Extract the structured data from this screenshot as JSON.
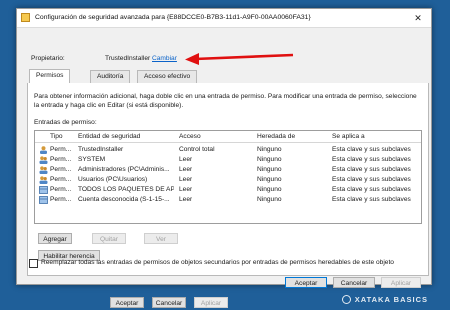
{
  "window": {
    "title": "Configuración de seguridad avanzada para {E88DCCE0-B7B3-11d1-A9F0-00AA0060FA31}",
    "close_symbol": "✕"
  },
  "owner": {
    "label": "Propietario:",
    "value": "TrustedInstaller",
    "change": "Cambiar"
  },
  "tabs": [
    {
      "label": "Permisos",
      "active": true
    },
    {
      "label": "Auditoría",
      "active": false
    },
    {
      "label": "Acceso efectivo",
      "active": false
    }
  ],
  "info_text": "Para obtener información adicional, haga doble clic en una entrada de permiso. Para modificar una entrada de permiso, seleccione la entrada y haga clic en Editar (si está disponible).",
  "entries_label": "Entradas de permiso:",
  "columns": [
    "Tipo",
    "Entidad de seguridad",
    "Acceso",
    "Heredada de",
    "Se aplica a"
  ],
  "rows": [
    {
      "icon": "user-icon",
      "type": "Perm...",
      "principal": "TrustedInstaller",
      "access": "Control total",
      "inherited": "Ninguno",
      "applies": "Esta clave y sus subclaves"
    },
    {
      "icon": "group-icon",
      "type": "Perm...",
      "principal": "SYSTEM",
      "access": "Leer",
      "inherited": "Ninguno",
      "applies": "Esta clave y sus subclaves"
    },
    {
      "icon": "group-icon",
      "type": "Perm...",
      "principal": "Administradores (PC\\Adminis...",
      "access": "Leer",
      "inherited": "Ninguno",
      "applies": "Esta clave y sus subclaves"
    },
    {
      "icon": "group-icon",
      "type": "Perm...",
      "principal": "Usuarios (PC\\Usuarios)",
      "access": "Leer",
      "inherited": "Ninguno",
      "applies": "Esta clave y sus subclaves"
    },
    {
      "icon": "package-icon",
      "type": "Perm...",
      "principal": "TODOS LOS PAQUETES DE AP...",
      "access": "Leer",
      "inherited": "Ninguno",
      "applies": "Esta clave y sus subclaves"
    },
    {
      "icon": "package-icon",
      "type": "Perm...",
      "principal": "Cuenta desconocida (S-1-15-...",
      "access": "Leer",
      "inherited": "Ninguno",
      "applies": "Esta clave y sus subclaves"
    }
  ],
  "buttons": {
    "add": "Agregar",
    "remove": "Quitar",
    "view": "Ver",
    "enable_inheritance": "Habilitar herencia",
    "ok": "Aceptar",
    "cancel": "Cancelar",
    "apply": "Aplicar"
  },
  "replace_checkbox": {
    "label": "Reemplazar todas las entradas de permisos de objetos secundarios por entradas de permisos heredables de este objeto",
    "checked": false
  },
  "background_dialog_buttons": {
    "ok": "Aceptar",
    "cancel": "Cancelar",
    "apply": "Aplicar"
  },
  "watermark": "XATAKA BASICS",
  "colors": {
    "desktop": "#1f5f99",
    "link": "#0b63c9",
    "arrow": "#e01010",
    "accent": "#0078d7"
  }
}
